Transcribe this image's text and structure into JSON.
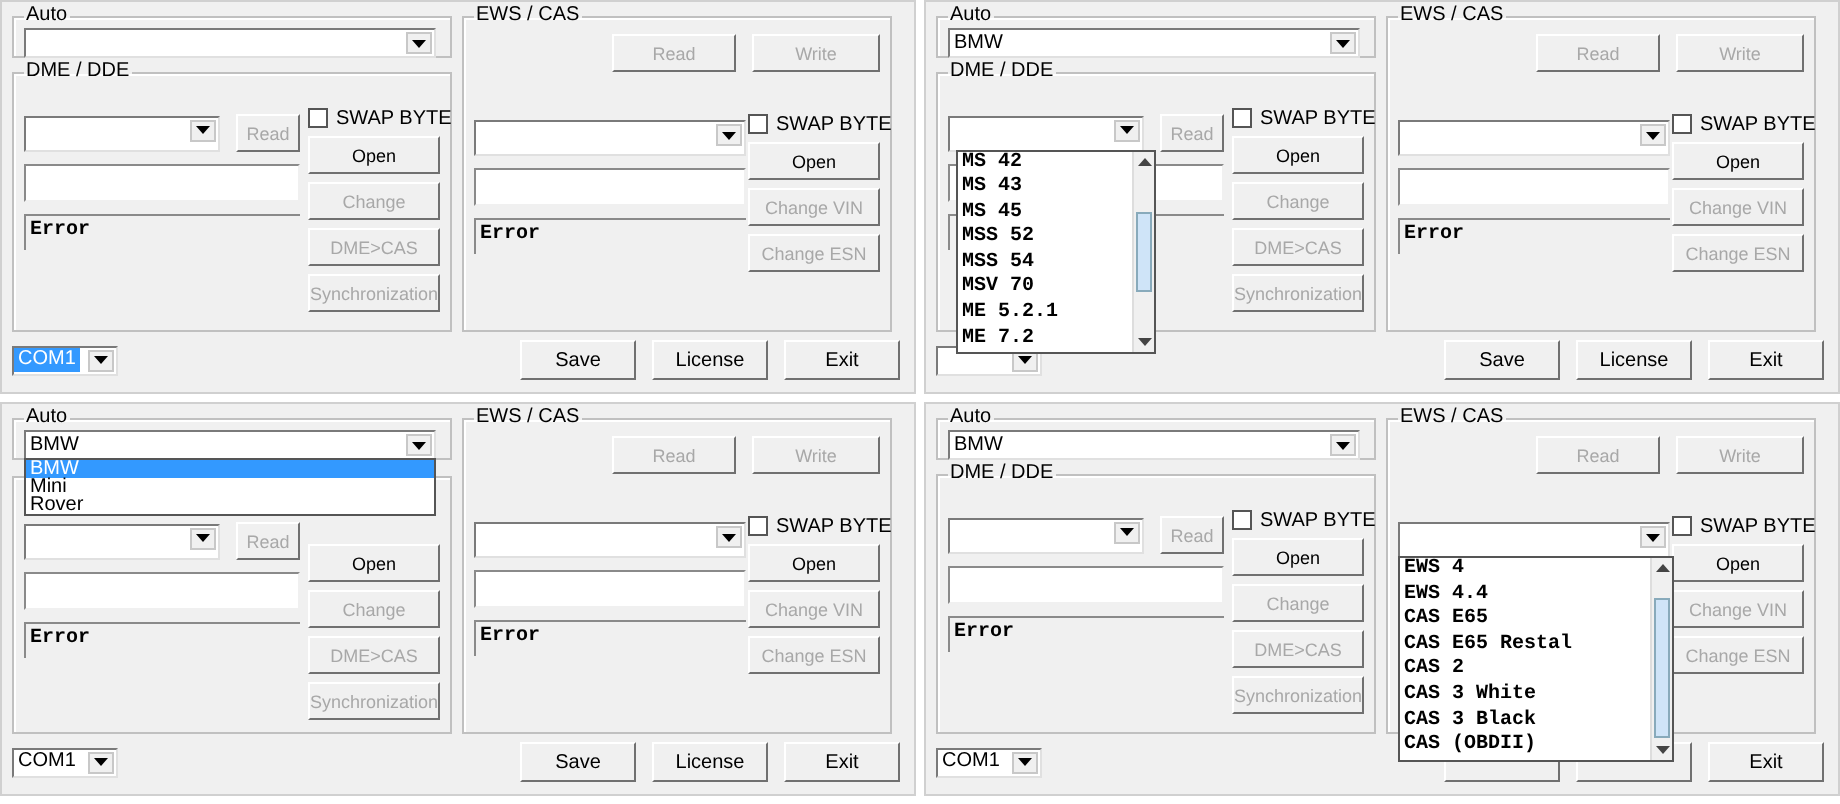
{
  "panels": [
    {
      "auto": {
        "title": "Auto"
      },
      "dme": {
        "title": "DME / DDE",
        "read": {
          "label": "Read",
          "disabled": true
        },
        "swap_byte": {
          "label": "SWAP BYTE",
          "checked": false
        },
        "buttons": [
          {
            "label": "Open",
            "disabled": false
          },
          {
            "label": "Change",
            "disabled": true
          },
          {
            "label": "DME>CAS",
            "disabled": true
          },
          {
            "label": "Synchronization",
            "disabled": true
          }
        ],
        "status": "Error"
      },
      "ews": {
        "title": "EWS / CAS",
        "top_buttons": [
          {
            "label": "Read",
            "disabled": true
          },
          {
            "label": "Write",
            "disabled": true
          }
        ],
        "swap_byte": {
          "label": "SWAP BYTE",
          "checked": false
        },
        "buttons": [
          {
            "label": "Open",
            "disabled": false
          },
          {
            "label": "Change VIN",
            "disabled": true
          },
          {
            "label": "Change ESN",
            "disabled": true
          }
        ],
        "status": "Error"
      },
      "footer": {
        "com": {
          "value": "COM1",
          "selected": true
        },
        "buttons": [
          {
            "label": "Save",
            "disabled": false
          },
          {
            "label": "License",
            "disabled": false
          },
          {
            "label": "Exit",
            "disabled": false
          }
        ]
      },
      "dropdown": {
        "kind": "none"
      }
    },
    {
      "auto": {
        "title": "Auto",
        "value": "BMW"
      },
      "dme": {
        "title": "DME / DDE",
        "read": {
          "label": "Read",
          "disabled": true
        },
        "swap_byte": {
          "label": "SWAP BYTE",
          "checked": false
        },
        "buttons": [
          {
            "label": "Open",
            "disabled": false
          },
          {
            "label": "Change",
            "disabled": true
          },
          {
            "label": "DME>CAS",
            "disabled": true
          },
          {
            "label": "Synchronization",
            "disabled": true
          }
        ]
      },
      "ews": {
        "title": "EWS / CAS",
        "top_buttons": [
          {
            "label": "Read",
            "disabled": true
          },
          {
            "label": "Write",
            "disabled": true
          }
        ],
        "swap_byte": {
          "label": "SWAP BYTE",
          "checked": false
        },
        "buttons": [
          {
            "label": "Open",
            "disabled": false
          },
          {
            "label": "Change VIN",
            "disabled": true
          },
          {
            "label": "Change ESN",
            "disabled": true
          }
        ],
        "status": "Error"
      },
      "footer": {
        "buttons": [
          {
            "label": "Save",
            "disabled": false
          },
          {
            "label": "License",
            "disabled": false
          },
          {
            "label": "Exit",
            "disabled": false
          }
        ]
      },
      "dropdown": {
        "kind": "dme",
        "scrollbar": true,
        "items": [
          {
            "label": "MS 42",
            "selected": false
          },
          {
            "label": "MS 43",
            "selected": false
          },
          {
            "label": "MS 45",
            "selected": false
          },
          {
            "label": "MSS 52",
            "selected": false
          },
          {
            "label": "MSS 54",
            "selected": false
          },
          {
            "label": "MSV 70",
            "selected": false
          },
          {
            "label": "ME 5.2.1",
            "selected": false
          },
          {
            "label": "ME 7.2",
            "selected": false
          }
        ]
      }
    },
    {
      "auto": {
        "title": "Auto",
        "value": "BMW"
      },
      "dme": {
        "read": {
          "label": "Read",
          "disabled": true
        },
        "buttons": [
          {
            "label": "Open",
            "disabled": false
          },
          {
            "label": "Change",
            "disabled": true
          },
          {
            "label": "DME>CAS",
            "disabled": true
          },
          {
            "label": "Synchronization",
            "disabled": true
          }
        ],
        "status": "Error"
      },
      "ews": {
        "title": "EWS / CAS",
        "top_buttons": [
          {
            "label": "Read",
            "disabled": true
          },
          {
            "label": "Write",
            "disabled": true
          }
        ],
        "swap_byte": {
          "label": "SWAP BYTE",
          "checked": false
        },
        "buttons": [
          {
            "label": "Open",
            "disabled": false
          },
          {
            "label": "Change VIN",
            "disabled": true
          },
          {
            "label": "Change ESN",
            "disabled": true
          }
        ],
        "status": "Error"
      },
      "footer": {
        "com": {
          "value": "COM1",
          "selected": false
        },
        "buttons": [
          {
            "label": "Save",
            "disabled": false
          },
          {
            "label": "License",
            "disabled": false
          },
          {
            "label": "Exit",
            "disabled": false
          }
        ]
      },
      "dropdown": {
        "kind": "auto",
        "items": [
          {
            "label": "BMW",
            "selected": true
          },
          {
            "label": "Mini",
            "selected": false
          },
          {
            "label": "Rover",
            "selected": false
          }
        ]
      }
    },
    {
      "auto": {
        "title": "Auto",
        "value": "BMW"
      },
      "dme": {
        "title": "DME / DDE",
        "read": {
          "label": "Read",
          "disabled": true
        },
        "swap_byte": {
          "label": "SWAP BYTE",
          "checked": false
        },
        "buttons": [
          {
            "label": "Open",
            "disabled": false
          },
          {
            "label": "Change",
            "disabled": true
          },
          {
            "label": "DME>CAS",
            "disabled": true
          },
          {
            "label": "Synchronization",
            "disabled": true
          }
        ],
        "status": "Error"
      },
      "ews": {
        "title": "EWS / CAS",
        "top_buttons": [
          {
            "label": "Read",
            "disabled": true
          },
          {
            "label": "Write",
            "disabled": true
          }
        ],
        "swap_byte": {
          "label": "SWAP BYTE",
          "checked": false
        },
        "buttons": [
          {
            "label": "Open",
            "disabled": false
          },
          {
            "label": "Change VIN",
            "disabled": true
          },
          {
            "label": "Change ESN",
            "disabled": true
          }
        ]
      },
      "footer": {
        "com": {
          "value": "COM1",
          "selected": false
        },
        "buttons": [
          {
            "label": "Exit",
            "disabled": false
          }
        ]
      },
      "dropdown": {
        "kind": "ews",
        "scrollbar": true,
        "items": [
          {
            "label": "EWS 4",
            "selected": false
          },
          {
            "label": "EWS 4.4",
            "selected": false
          },
          {
            "label": "CAS E65",
            "selected": false
          },
          {
            "label": "CAS E65 Restal",
            "selected": false
          },
          {
            "label": "CAS 2",
            "selected": false
          },
          {
            "label": "CAS 3 White",
            "selected": false
          },
          {
            "label": "CAS 3 Black",
            "selected": false
          },
          {
            "label": "CAS (OBDII)",
            "selected": false
          }
        ]
      }
    }
  ]
}
